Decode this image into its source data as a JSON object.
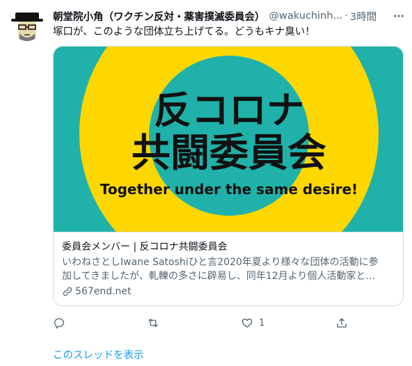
{
  "tweet": {
    "author_name": "朝堂院小角（ワクチン反対・薬害撲滅委員会）",
    "handle": "@wakuchinh...",
    "separator": "·",
    "time": "3時間",
    "text": "塚口が、このような団体立ち上げてる。どうもキナ臭い！"
  },
  "card": {
    "image_title_line1": "反コロナ",
    "image_title_line2": "共闘委員会",
    "image_slogan": "Together under the same desire!",
    "title": "委員会メンバー | 反コロナ共闘委員会",
    "description_line1": "いわねさとしIwane Satoshiひと言2020年夏より様々な団体の活動に参",
    "description_line2": "加してきましたが、軋轢の多さに辟易し、同年12月より個人活動家と…",
    "domain": "567end.net"
  },
  "actions": {
    "like_count": "1"
  },
  "thread_link": "このスレッドを表示",
  "icons": {
    "more": "more-icon",
    "reply": "reply-icon",
    "retweet": "retweet-icon",
    "like": "heart-icon",
    "share": "share-icon",
    "link": "link-icon"
  },
  "colors": {
    "card_bg": "#20b2aa",
    "circle_yellow": "#ffd700",
    "inner_teal": "#20b2aa",
    "link_blue": "#1d9bf0",
    "muted": "#536471"
  }
}
